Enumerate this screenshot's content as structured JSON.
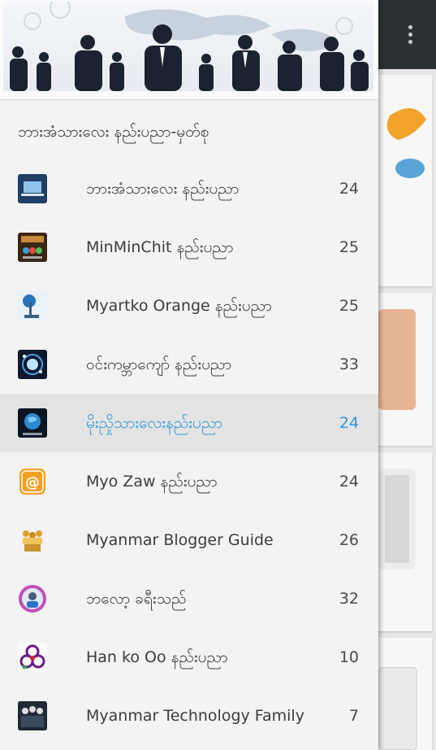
{
  "drawer": {
    "archive_title": "ဘားအံသားလေး နည်းပညာ-မှတ်စု",
    "selected_index": 4,
    "items": [
      {
        "name": "ဘားအံသားလေး နည်းပညာ",
        "count": "24",
        "icon": "laptop-thumb"
      },
      {
        "name": "MinMinChit  နည်းပညာ",
        "count": "25",
        "icon": "minminchit-thumb"
      },
      {
        "name": "Myartko Orange နည်းပညာ",
        "count": "25",
        "icon": "desk-lamp-thumb"
      },
      {
        "name": "ဝင်းကမ္ဘာကျော် နည်းပညာ",
        "count": "33",
        "icon": "light-burst-thumb"
      },
      {
        "name": "မိုးညှိုသားလေးနည်းပညာ",
        "count": "24",
        "icon": "globe-thumb"
      },
      {
        "name": "Myo Zaw နည်းပညာ",
        "count": "24",
        "icon": "at-sign-thumb"
      },
      {
        "name": "Myanmar Blogger Guide",
        "count": "26",
        "icon": "people-thumb"
      },
      {
        "name": "ဘလော့ ခရီးသည်",
        "count": "32",
        "icon": "portrait-thumb"
      },
      {
        "name": "Han ko Oo နည်းပညာ",
        "count": "10",
        "icon": "biohazard-thumb"
      },
      {
        "name": "Myanmar Technology Family",
        "count": "7",
        "icon": "tech-family-thumb"
      }
    ]
  },
  "colors": {
    "accent": "#2e9ad6",
    "app_bar": "#2b3133",
    "drawer_bg": "#f3f3f3",
    "selected_bg": "#e3e3e3"
  }
}
